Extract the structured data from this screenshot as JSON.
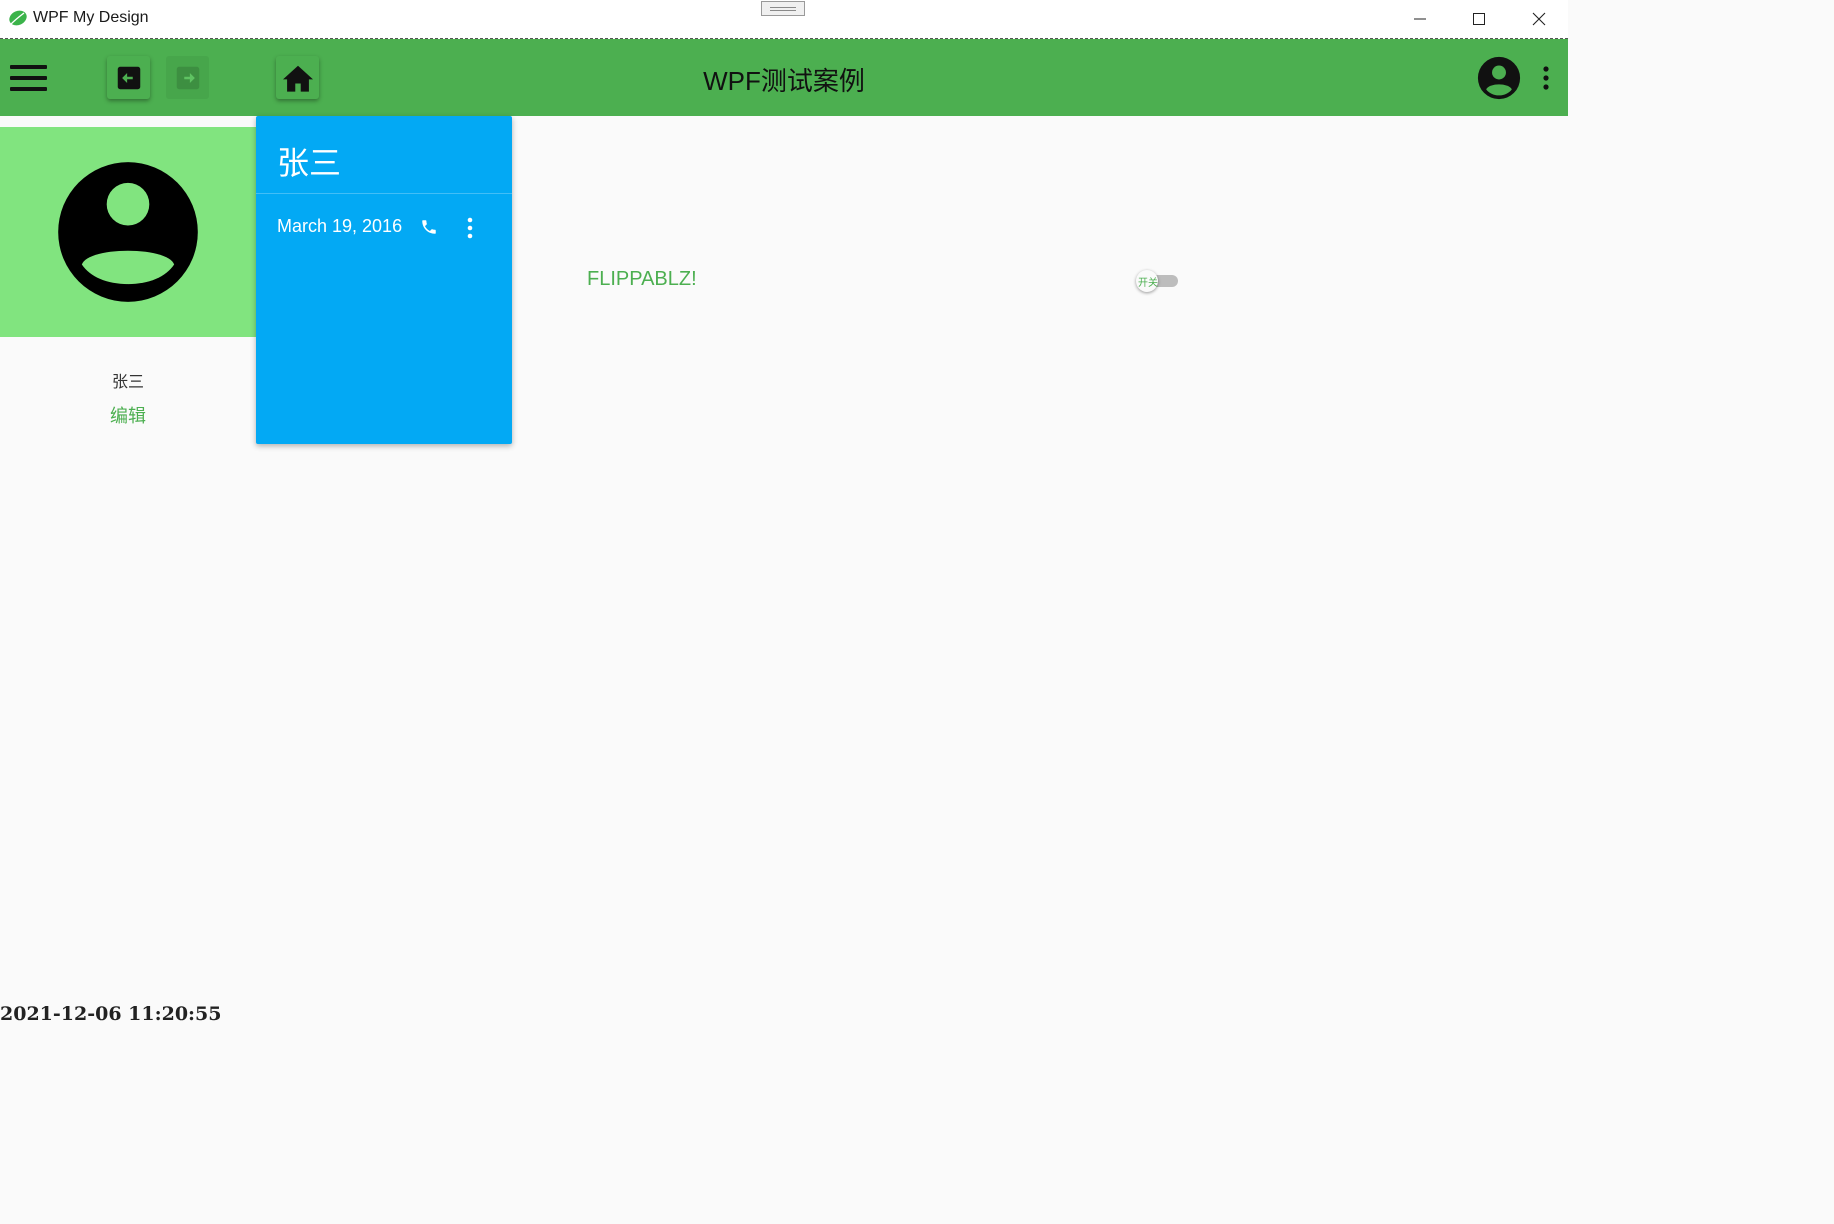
{
  "window": {
    "title": "WPF My Design",
    "icon": "leaf-icon",
    "controls": [
      "minimize-icon",
      "maximize-icon",
      "close-icon"
    ]
  },
  "appbar": {
    "title": "WPF测试案例",
    "color": "#4caf50",
    "menu_icon": "hamburger-icon",
    "back_icon": "arrow-left-box-icon",
    "forward_icon": "arrow-right-box-icon",
    "forward_enabled": false,
    "home_icon": "home-icon",
    "account_icon": "account-circle-icon",
    "more_icon": "dots-vertical-icon"
  },
  "profile": {
    "banner_color": "#81e47f",
    "avatar_icon": "account-circle-icon",
    "name": "张三",
    "edit_label": "编辑"
  },
  "card": {
    "color": "#03a9f4",
    "title": "张三",
    "date": "March 19, 2016",
    "phone_icon": "phone-icon",
    "more_icon": "dots-vertical-icon"
  },
  "flip": {
    "label": "FLIPPABLZ!",
    "toggle_label": "开关",
    "toggle_on": false
  },
  "footer": {
    "clock": "2021-12-06 11:20:55"
  }
}
